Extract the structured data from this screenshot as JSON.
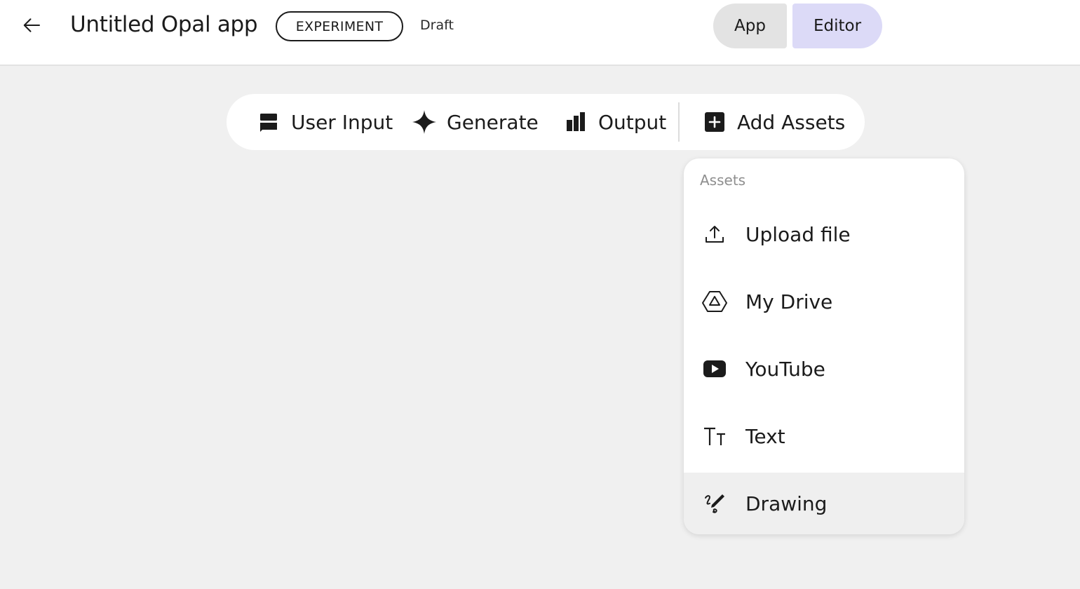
{
  "header": {
    "title": "Untitled Opal app",
    "badge": "EXPERIMENT",
    "status": "Draft",
    "modes": [
      {
        "label": "App"
      },
      {
        "label": "Editor",
        "active": true
      }
    ]
  },
  "toolbar": {
    "items": [
      {
        "label": "User Input",
        "icon": "user-input-icon"
      },
      {
        "label": "Generate",
        "icon": "sparkle-icon"
      },
      {
        "label": "Output",
        "icon": "output-icon"
      },
      {
        "label": "Add Assets",
        "icon": "add-box-icon"
      }
    ]
  },
  "assets_menu": {
    "heading": "Assets",
    "items": [
      {
        "label": "Upload file",
        "icon": "upload-icon"
      },
      {
        "label": "My Drive",
        "icon": "drive-icon"
      },
      {
        "label": "YouTube",
        "icon": "youtube-icon"
      },
      {
        "label": "Text",
        "icon": "text-icon"
      },
      {
        "label": "Drawing",
        "icon": "drawing-icon",
        "highlighted": true
      }
    ]
  },
  "colors": {
    "background": "#f0f0f0",
    "editor_active": "#dcdaf7",
    "app_inactive": "#e3e3e3"
  }
}
